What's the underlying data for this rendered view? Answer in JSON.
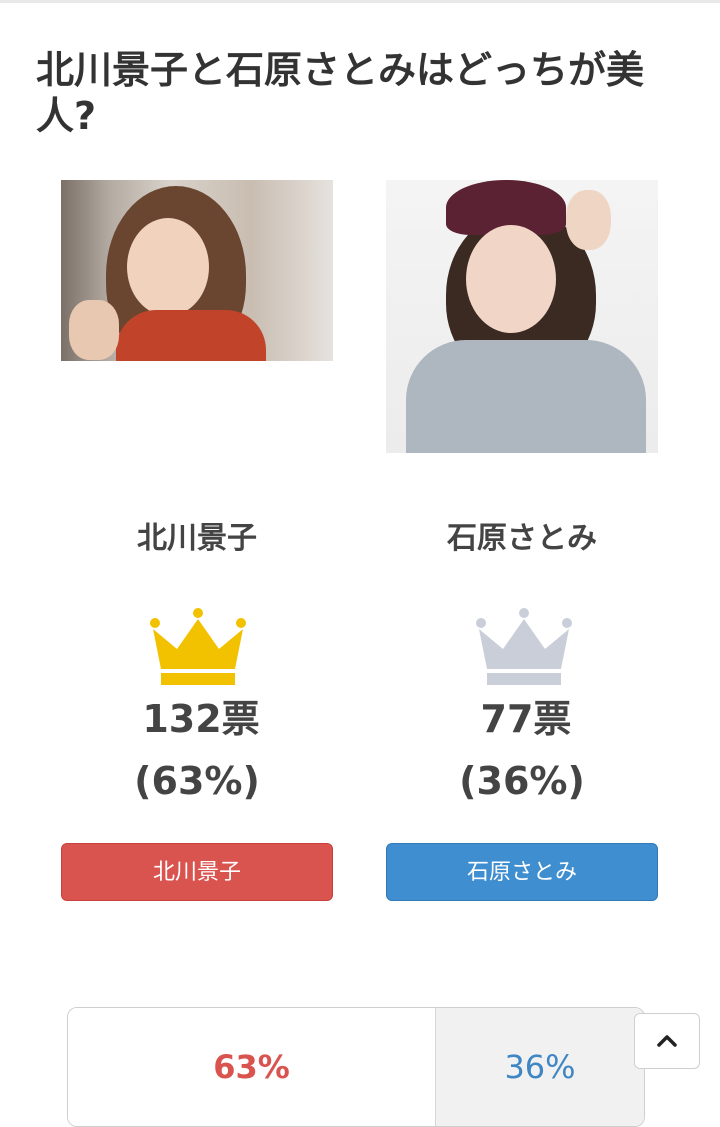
{
  "page": {
    "title": "北川景子と石原さとみはどっちが美人?"
  },
  "candidates": [
    {
      "name": "北川景子",
      "votes": "132票",
      "percent": "(63%)",
      "button_label": "北川景子",
      "photo_icon": "person-photo",
      "crown": "gold-crown-icon"
    },
    {
      "name": "石原さとみ",
      "votes": "77票",
      "percent": "(36%)",
      "button_label": "石原さとみ",
      "photo_icon": "person-photo",
      "crown": "silver-crown-icon"
    }
  ],
  "result_bar": {
    "left_percent": "63%",
    "right_percent": "36%",
    "left_share": 0.63,
    "right_share": 0.36
  },
  "colors": {
    "red": "#d9534f",
    "blue": "#3f8ed0",
    "gold": "#f2c200",
    "silver": "#c9ced8"
  }
}
